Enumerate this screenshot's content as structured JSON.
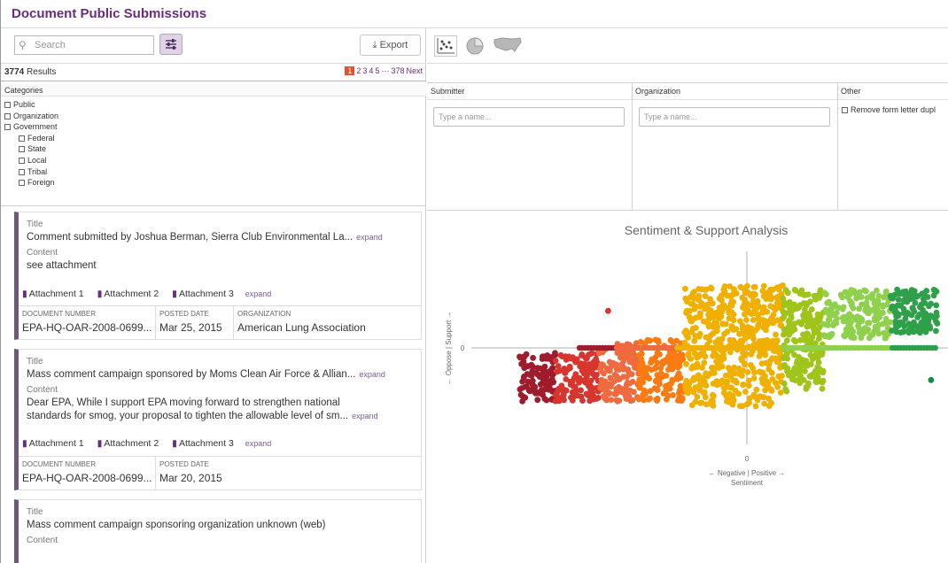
{
  "page": {
    "title": "Document Public Submissions"
  },
  "toolbar": {
    "search_placeholder": "Search",
    "export_label": "Export"
  },
  "results": {
    "count": "3774",
    "label": "Results",
    "pages": [
      "1",
      "2",
      "3",
      "4",
      "5",
      "···",
      "378",
      "Next"
    ],
    "current_page": "1"
  },
  "categories": {
    "header": "Categories",
    "items": [
      "Public",
      "Organization",
      "Government"
    ],
    "sub_items": [
      "Federal",
      "State",
      "Local",
      "Tribal",
      "Foreign"
    ]
  },
  "cards": [
    {
      "title_label": "Title",
      "title": "Comment submitted by Joshua Berman, Sierra Club Environmental La...",
      "content_label": "Content",
      "content": "see attachment",
      "content_expand": "",
      "expand_label": "expand",
      "attachments": [
        "Attachment 1",
        "Attachment 2",
        "Attachment 3"
      ],
      "doc_label": "DOCUMENT NUMBER",
      "doc_number": "EPA-HQ-OAR-2008-0699...",
      "posted_label": "POSTED DATE",
      "posted_date": "Mar 25, 2015",
      "org_label": "ORGANIZATION",
      "organization": "American Lung Association"
    },
    {
      "title_label": "Title",
      "title": "Mass comment campaign sponsored by Moms Clean Air Force & Allian...",
      "content_label": "Content",
      "content_line1": "Dear EPA, While I support EPA moving forward to strengthen national",
      "content_line2": "standards for smog, your proposal to tighten the allowable level of sm...",
      "expand_label": "expand",
      "attachments": [
        "Attachment 1",
        "Attachment 2",
        "Attachment 3"
      ],
      "doc_label": "DOCUMENT NUMBER",
      "doc_number": "EPA-HQ-OAR-2008-0699...",
      "posted_label": "POSTED DATE",
      "posted_date": "Mar 20, 2015"
    },
    {
      "title_label": "Title",
      "title": "Mass comment campaign sponsoring organization unknown (web)",
      "content_label": "Content"
    }
  ],
  "filters": {
    "submitter_header": "Submitter",
    "organization_header": "Organization",
    "other_header": "Other",
    "name_placeholder": "Type a name...",
    "remove_duplicates": "Remove form letter dupl"
  },
  "chart_data": {
    "type": "scatter",
    "title": "Sentiment & Support Analysis",
    "xlabel": "← Negative | Positive →",
    "xlabel2": "Sentiment",
    "ylabel": "← Oppose | Support →",
    "x_tick": "0",
    "y_tick": "0",
    "colors": [
      "#a01c2c",
      "#d7362e",
      "#ef6a3e",
      "#fb7a12",
      "#f0b000",
      "#9fc41a",
      "#8fd04c",
      "#2ea04a",
      "#109040"
    ],
    "bands": [
      {
        "x": [
          -0.95,
          -0.8
        ],
        "y": [
          -0.55,
          -0.05
        ],
        "color": "#a01c2c"
      },
      {
        "x": [
          -0.8,
          -0.62
        ],
        "y": [
          -0.55,
          -0.05
        ],
        "color": "#d7362e"
      },
      {
        "x": [
          -0.62,
          -0.45
        ],
        "y": [
          -0.55,
          0.05
        ],
        "color": "#ef6a3e"
      },
      {
        "x": [
          -0.45,
          -0.26
        ],
        "y": [
          -0.55,
          0.1
        ],
        "color": "#fb7a12"
      },
      {
        "x": [
          -0.26,
          0.15
        ],
        "y": [
          -0.6,
          0.65
        ],
        "color": "#f0b000"
      },
      {
        "x": [
          0.15,
          0.32
        ],
        "y": [
          -0.45,
          0.6
        ],
        "color": "#9fc41a"
      },
      {
        "x": [
          0.32,
          0.6
        ],
        "y": [
          0.1,
          0.6
        ],
        "color": "#8fd04c"
      },
      {
        "x": [
          0.6,
          0.8
        ],
        "y": [
          0.15,
          0.6
        ],
        "color": "#2ea04a"
      }
    ],
    "neutral_line": {
      "y": 0.0,
      "x": [
        -0.7,
        0.8
      ]
    }
  }
}
